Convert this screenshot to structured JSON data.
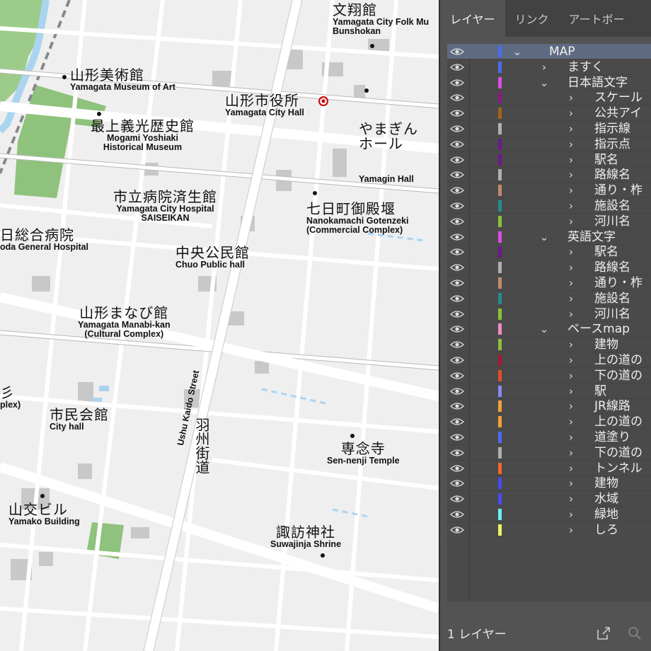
{
  "map": {
    "labels": [
      {
        "id": "bunshokan",
        "ja": "文翔館",
        "en": [
          "Yamagata City Folk Mu",
          "Bunshokan"
        ]
      },
      {
        "id": "museum-of-art",
        "ja": "山形美術館",
        "en": [
          "Yamagata Museum of Art"
        ]
      },
      {
        "id": "city-hall",
        "ja": "山形市役所",
        "en": [
          "Yamagata City Hall"
        ]
      },
      {
        "id": "yamagin-hall",
        "ja": "やまぎん\nホール",
        "en": [
          "Yamagin Hall"
        ]
      },
      {
        "id": "mogami-museum",
        "ja": "最上義光歴史館",
        "en": [
          "Mogami Yoshiaki",
          "Historical Museum"
        ]
      },
      {
        "id": "saiseikan",
        "ja": "市立病院済生館",
        "en": [
          "Yamagata City Hospital",
          "SAISEIKAN"
        ]
      },
      {
        "id": "gotenzeki",
        "ja": "七日町御殿堰",
        "en": [
          "Nanokamachi Gotenzeki",
          "(Commercial Complex)"
        ]
      },
      {
        "id": "general-hospital",
        "ja": "日総合病院",
        "en": [
          "oda General Hospital"
        ]
      },
      {
        "id": "chuo-public-hall",
        "ja": "中央公民館",
        "en": [
          "Chuo Public hall"
        ]
      },
      {
        "id": "manabi-kan",
        "ja": "山形まなび館",
        "en": [
          "Yamagata Manabi-kan",
          "(Cultural Complex)"
        ]
      },
      {
        "id": "partial-left",
        "ja": "彡",
        "en": [
          "plex)"
        ]
      },
      {
        "id": "shimin-kaikan",
        "ja": "市民会館",
        "en": [
          "City hall"
        ]
      },
      {
        "id": "sennenji",
        "ja": "専念寺",
        "en": [
          "Sen-nenji Temple"
        ]
      },
      {
        "id": "yamako",
        "ja": "山交ビル",
        "en": [
          "Yamako Building"
        ]
      },
      {
        "id": "suwajinja",
        "ja": "諏訪神社",
        "en": [
          "Suwajinja Shrine"
        ]
      }
    ],
    "street": {
      "ja": "羽州街道",
      "en": "Ushu Kaido Street"
    }
  },
  "panel": {
    "tabs": [
      "レイヤー",
      "リンク",
      "アートボー"
    ],
    "rows": [
      {
        "name": "MAP",
        "indent": 0,
        "open": true,
        "color": "#4a6cf0",
        "selected": true
      },
      {
        "name": "ますく",
        "indent": 1,
        "open": false,
        "color": "#4a6cf0"
      },
      {
        "name": "日本語文字",
        "indent": 1,
        "open": true,
        "color": "#e04de0"
      },
      {
        "name": "スケール",
        "indent": 2,
        "open": false,
        "color": "#8a1a8a"
      },
      {
        "name": "公共アイ",
        "indent": 2,
        "open": false,
        "color": "#a0641e"
      },
      {
        "name": "指示線",
        "indent": 2,
        "open": false,
        "color": "#b0b0b0"
      },
      {
        "name": "指示点",
        "indent": 2,
        "open": false,
        "color": "#6a1a8a"
      },
      {
        "name": "駅名",
        "indent": 2,
        "open": false,
        "color": "#6a1a8a"
      },
      {
        "name": "路線名",
        "indent": 2,
        "open": false,
        "color": "#b0b0b0"
      },
      {
        "name": "通り・柞",
        "indent": 2,
        "open": false,
        "color": "#c08a6a"
      },
      {
        "name": "施設名",
        "indent": 2,
        "open": false,
        "color": "#2a8a8a"
      },
      {
        "name": "河川名",
        "indent": 2,
        "open": false,
        "color": "#8ac03a"
      },
      {
        "name": "英語文字",
        "indent": 1,
        "open": true,
        "color": "#e04de0"
      },
      {
        "name": "駅名",
        "indent": 2,
        "open": false,
        "color": "#6a1a8a"
      },
      {
        "name": "路線名",
        "indent": 2,
        "open": false,
        "color": "#b0b0b0"
      },
      {
        "name": "通り・柞",
        "indent": 2,
        "open": false,
        "color": "#c08a6a"
      },
      {
        "name": "施設名",
        "indent": 2,
        "open": false,
        "color": "#2a8a8a"
      },
      {
        "name": "河川名",
        "indent": 2,
        "open": false,
        "color": "#8ac03a"
      },
      {
        "name": "ベースmap",
        "indent": 1,
        "open": true,
        "color": "#f08ac8"
      },
      {
        "name": "建物",
        "indent": 2,
        "open": false,
        "color": "#8ac03a"
      },
      {
        "name": "上の道の",
        "indent": 2,
        "open": false,
        "color": "#a01a3a"
      },
      {
        "name": "下の道の",
        "indent": 2,
        "open": false,
        "color": "#e0502a"
      },
      {
        "name": "駅",
        "indent": 2,
        "open": false,
        "color": "#8a8af0"
      },
      {
        "name": "JR線路",
        "indent": 2,
        "open": false,
        "color": "#f0a03a"
      },
      {
        "name": "上の道の",
        "indent": 2,
        "open": false,
        "color": "#f0a03a"
      },
      {
        "name": "道塗り",
        "indent": 2,
        "open": false,
        "color": "#4a6cf0"
      },
      {
        "name": "下の道の",
        "indent": 2,
        "open": false,
        "color": "#b0b0b0"
      },
      {
        "name": "トンネル",
        "indent": 2,
        "open": false,
        "color": "#f06a2a"
      },
      {
        "name": "建物",
        "indent": 2,
        "open": false,
        "color": "#4a4af0"
      },
      {
        "name": "水域",
        "indent": 2,
        "open": false,
        "color": "#4a4af0"
      },
      {
        "name": "緑地",
        "indent": 2,
        "open": false,
        "color": "#6af0f0"
      },
      {
        "name": "しろ",
        "indent": 2,
        "open": false,
        "color": "#f0f06a"
      }
    ],
    "footer": {
      "count": "1 レイヤー"
    }
  }
}
